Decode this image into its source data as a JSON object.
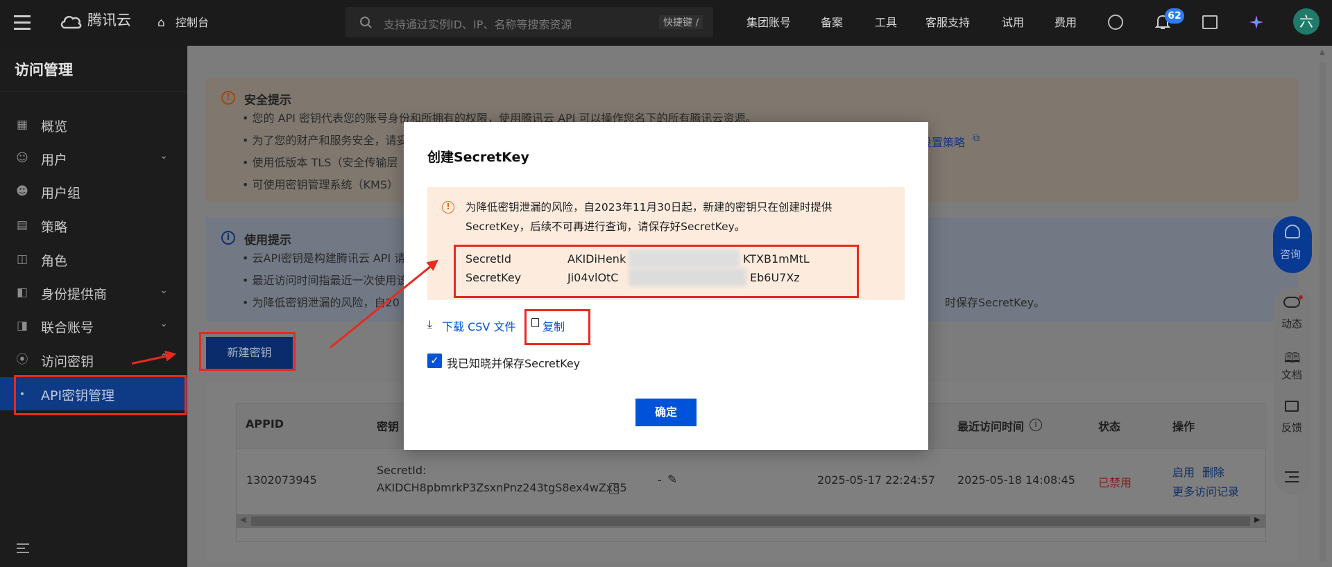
{
  "topbar": {
    "brand": "腾讯云",
    "console": "控制台",
    "search_placeholder": "支持通过实例ID、IP、名称等搜索资源",
    "shortcut": "快捷键 /",
    "links": [
      "集团账号",
      "备案",
      "工具",
      "客服支持",
      "试用",
      "费用"
    ],
    "notification_count": "62",
    "avatar_letter": "六"
  },
  "sidebar": {
    "title": "访问管理",
    "items": [
      {
        "label": "概览",
        "icon": "grid-icon",
        "chevron": false
      },
      {
        "label": "用户",
        "icon": "user-icon",
        "chevron": true
      },
      {
        "label": "用户组",
        "icon": "users-icon",
        "chevron": false
      },
      {
        "label": "策略",
        "icon": "policy-icon",
        "chevron": false
      },
      {
        "label": "角色",
        "icon": "role-icon",
        "chevron": false
      },
      {
        "label": "身份提供商",
        "icon": "idp-icon",
        "chevron": true
      },
      {
        "label": "联合账号",
        "icon": "federated-icon",
        "chevron": true
      },
      {
        "label": "访问密钥",
        "icon": "key-icon",
        "chevron": true
      }
    ],
    "active_item": "API密钥管理"
  },
  "security_tip": {
    "title": "安全提示",
    "bullets": [
      "您的 API 密钥代表您的账号身份和所拥有的权限，使用腾讯云 API 可以操作您名下的所有腾讯云资源。",
      "为了您的财产和服务安全，请妥",
      "使用低版本 TLS（安全传输层",
      "可使用密钥管理系统（KMS）"
    ],
    "link": "设置策略"
  },
  "usage_tip": {
    "title": "使用提示",
    "bullets": [
      "云API密钥是构建腾讯云 API 请",
      "最近访问时间指最近一次使用该",
      "为降低密钥泄漏的风险，自20"
    ],
    "tail": "时保存SecretKey。"
  },
  "new_key_button": "新建密钥",
  "table": {
    "headers": [
      "APPID",
      "密钥",
      "最近访问时间",
      "状态",
      "操作"
    ],
    "row": {
      "appid": "1302073945",
      "secret_id_label": "SecretId:",
      "secret_id": "AKIDCH8pbmrkP3ZsxnPnz243tgS8ex4wZx85",
      "remark": "-",
      "created": "2025-05-17 22:24:57",
      "last_access": "2025-05-18 14:08:45",
      "status": "已禁用",
      "actions": [
        "启用",
        "删除",
        "更多访问记录"
      ]
    }
  },
  "modal": {
    "title": "创建SecretKey",
    "warning_line1": "为降低密钥泄漏的风险，自2023年11月30日起，新建的密钥只在创建时提供",
    "warning_line2": "SecretKey，后续不可再进行查询，请保存好SecretKey。",
    "secret_id_label": "SecretId",
    "secret_id_start": "AKIDiHenk",
    "secret_id_end": "KTXB1mMtL",
    "secret_key_label": "SecretKey",
    "secret_key_start": "Ji04vlOtC",
    "secret_key_end": "Eb6U7Xz",
    "download_csv": "下载 CSV 文件",
    "copy": "复制",
    "checkbox_label": "我已知晓并保存SecretKey",
    "confirm": "确定"
  },
  "float_panel": {
    "consult": "咨询",
    "items": [
      "动态",
      "文档",
      "反馈"
    ]
  },
  "colors": {
    "primary": "#0052d9",
    "danger": "#e54545",
    "annotation": "#e8291f"
  }
}
